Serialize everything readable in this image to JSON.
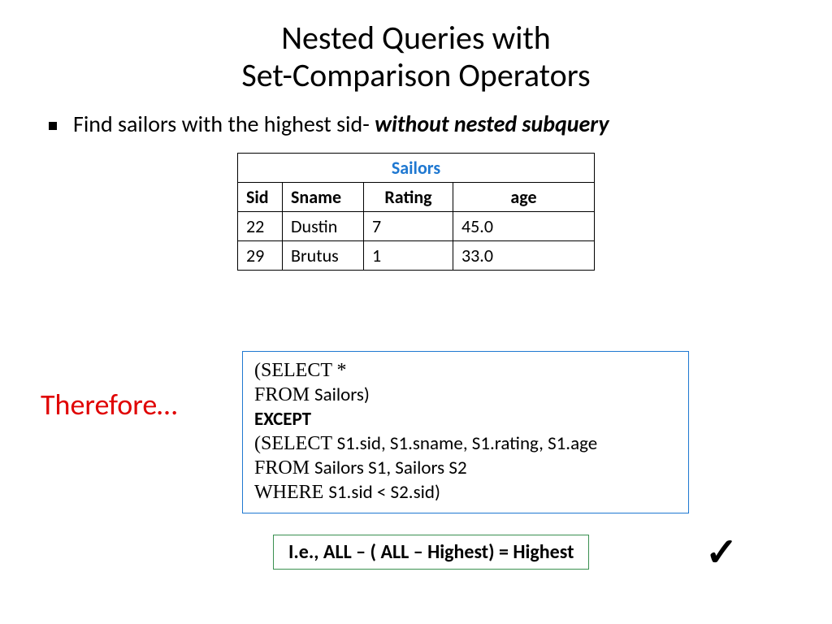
{
  "title_line1": "Nested Queries with",
  "title_line2": "Set-Comparison Operators",
  "bullet_prefix": "Find sailors with the highest sid- ",
  "bullet_emph": "without nested subquery",
  "table": {
    "title": "Sailors",
    "headers": {
      "c1": "Sid",
      "c2": "Sname",
      "c3": "Rating",
      "c4": "age"
    },
    "rows": [
      {
        "c1": "22",
        "c2": "Dustin",
        "c3": "7",
        "c4": "45.0"
      },
      {
        "c1": "29",
        "c2": "Brutus",
        "c3": "1",
        "c4": "33.0"
      }
    ]
  },
  "therefore": "Therefore…",
  "sql": {
    "l1a": "(SELECT *",
    "l2a": "FROM ",
    "l2b": "Sailors)",
    "l3": "EXCEPT",
    "l4a": "(SELECT  ",
    "l4b": "S1.sid, S1.sname, S1.rating, S1.age",
    "l5a": "FROM  ",
    "l5b": "Sailors S1, Sailors S2",
    "l6a": "WHERE  ",
    "l6b": "S1.sid < S2.sid)"
  },
  "summary": "I.e., ALL – ( ALL – Highest) = Highest",
  "check": "✓"
}
